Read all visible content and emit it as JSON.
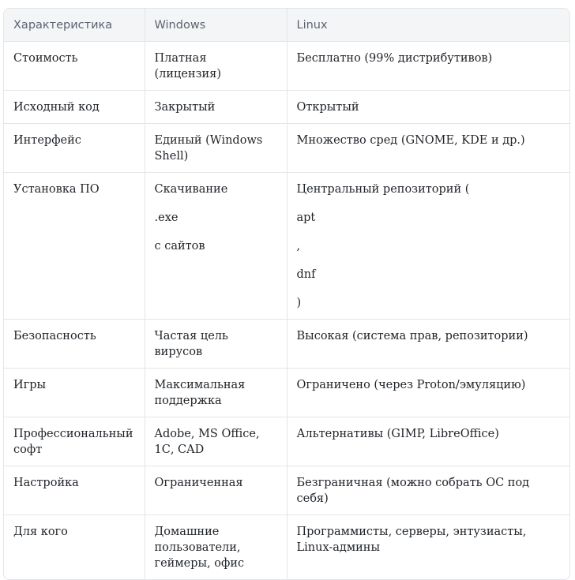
{
  "table": {
    "headers": [
      "Характеристика",
      "Windows",
      "Linux"
    ],
    "rows": [
      {
        "feature": "Стоимость",
        "windows": [
          "Платная (лицензия)"
        ],
        "linux": [
          "Бесплатно (99% дистрибутивов)"
        ]
      },
      {
        "feature": "Исходный код",
        "windows": [
          "Закрытый"
        ],
        "linux": [
          "Открытый"
        ]
      },
      {
        "feature": "Интерфейс",
        "windows": [
          "Единый (Windows Shell)"
        ],
        "linux": [
          "Множество сред (GNOME, KDE и др.)"
        ]
      },
      {
        "feature": "Установка ПО",
        "windows": [
          "Скачивание",
          ".exe",
          "с сайтов"
        ],
        "linux": [
          "Центральный репозиторий (",
          "apt",
          ",",
          "dnf",
          ")"
        ]
      },
      {
        "feature": "Безопасность",
        "windows": [
          "Частая цель вирусов"
        ],
        "linux": [
          "Высокая (система прав, репозитории)"
        ]
      },
      {
        "feature": "Игры",
        "windows": [
          "Максимальная поддержка"
        ],
        "linux": [
          "Ограничено (через Proton/эмуляцию)"
        ]
      },
      {
        "feature": "Профессиональный софт",
        "windows": [
          "Adobe, MS Office, 1С, CAD"
        ],
        "linux": [
          "Альтернативы (GIMP, LibreOffice)"
        ]
      },
      {
        "feature": "Настройка",
        "windows": [
          "Ограниченная"
        ],
        "linux": [
          "Безграничная (можно собрать ОС под себя)"
        ]
      },
      {
        "feature": "Для кого",
        "windows": [
          "Домашние пользователи, геймеры, офис"
        ],
        "linux": [
          "Программисты, серверы, энтузиасты, Linux-админы"
        ]
      }
    ]
  }
}
